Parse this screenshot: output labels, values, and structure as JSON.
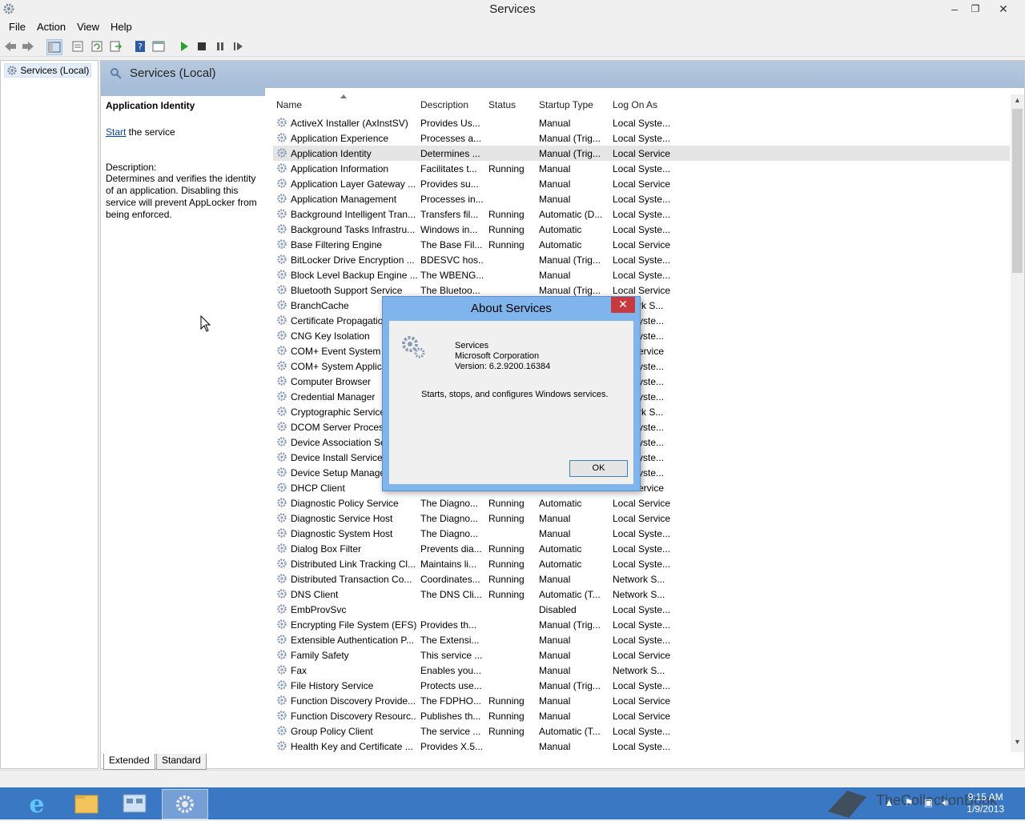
{
  "window": {
    "title": "Services",
    "minimize": "–",
    "restore": "❐",
    "close": "✕"
  },
  "menu": [
    "File",
    "Action",
    "View",
    "Help"
  ],
  "tree": {
    "root": "Services (Local)"
  },
  "pane": {
    "header": "Services (Local)",
    "selected_name": "Application Identity",
    "start_link": "Start",
    "start_suffix": " the service",
    "description_label": "Description:",
    "description_text": "Determines and verifies the identity of an application. Disabling this service will prevent AppLocker from being enforced."
  },
  "columns": [
    "Name",
    "Description",
    "Status",
    "Startup Type",
    "Log On As"
  ],
  "rows": [
    {
      "name": "ActiveX Installer (AxInstSV)",
      "desc": "Provides Us...",
      "status": "",
      "startup": "Manual",
      "logon": "Local Syste..."
    },
    {
      "name": "Application Experience",
      "desc": "Processes a...",
      "status": "",
      "startup": "Manual (Trig...",
      "logon": "Local Syste..."
    },
    {
      "name": "Application Identity",
      "desc": "Determines ...",
      "status": "",
      "startup": "Manual (Trig...",
      "logon": "Local Service"
    },
    {
      "name": "Application Information",
      "desc": "Facilitates t...",
      "status": "Running",
      "startup": "Manual",
      "logon": "Local Syste..."
    },
    {
      "name": "Application Layer Gateway ...",
      "desc": "Provides su...",
      "status": "",
      "startup": "Manual",
      "logon": "Local Service"
    },
    {
      "name": "Application Management",
      "desc": "Processes in...",
      "status": "",
      "startup": "Manual",
      "logon": "Local Syste..."
    },
    {
      "name": "Background Intelligent Tran...",
      "desc": "Transfers fil...",
      "status": "Running",
      "startup": "Automatic (D...",
      "logon": "Local Syste..."
    },
    {
      "name": "Background Tasks Infrastru...",
      "desc": "Windows in...",
      "status": "Running",
      "startup": "Automatic",
      "logon": "Local Syste..."
    },
    {
      "name": "Base Filtering Engine",
      "desc": "The Base Fil...",
      "status": "Running",
      "startup": "Automatic",
      "logon": "Local Service"
    },
    {
      "name": "BitLocker Drive Encryption ...",
      "desc": "BDESVC hos...",
      "status": "",
      "startup": "Manual (Trig...",
      "logon": "Local Syste..."
    },
    {
      "name": "Block Level Backup Engine ...",
      "desc": "The WBENG...",
      "status": "",
      "startup": "Manual",
      "logon": "Local Syste..."
    },
    {
      "name": "Bluetooth Support Service",
      "desc": "The Bluetoo...",
      "status": "",
      "startup": "Manual (Trig...",
      "logon": "Local Service"
    },
    {
      "name": "BranchCache",
      "desc": "",
      "status": "",
      "startup": "",
      "logon": "rk S..."
    },
    {
      "name": "Certificate Propagation",
      "desc": "",
      "status": "",
      "startup": "",
      "logon": "yste..."
    },
    {
      "name": "CNG Key Isolation",
      "desc": "",
      "status": "",
      "startup": "",
      "logon": "yste..."
    },
    {
      "name": "COM+ Event System",
      "desc": "",
      "status": "",
      "startup": "",
      "logon": "ervice"
    },
    {
      "name": "COM+ System Applica",
      "desc": "",
      "status": "",
      "startup": "",
      "logon": "yste..."
    },
    {
      "name": "Computer Browser",
      "desc": "",
      "status": "",
      "startup": "",
      "logon": "yste..."
    },
    {
      "name": "Credential Manager",
      "desc": "",
      "status": "",
      "startup": "",
      "logon": "yste..."
    },
    {
      "name": "Cryptographic Service",
      "desc": "",
      "status": "",
      "startup": "",
      "logon": "rk S..."
    },
    {
      "name": "DCOM Server Process",
      "desc": "",
      "status": "",
      "startup": "",
      "logon": "yste..."
    },
    {
      "name": "Device Association Se",
      "desc": "",
      "status": "",
      "startup": "",
      "logon": "yste..."
    },
    {
      "name": "Device Install Service",
      "desc": "",
      "status": "",
      "startup": "",
      "logon": "yste..."
    },
    {
      "name": "Device Setup Manager",
      "desc": "",
      "status": "",
      "startup": "",
      "logon": "yste..."
    },
    {
      "name": "DHCP Client",
      "desc": "",
      "status": "",
      "startup": "",
      "logon": "ervice"
    },
    {
      "name": "Diagnostic Policy Service",
      "desc": "The Diagno...",
      "status": "Running",
      "startup": "Automatic",
      "logon": "Local Service"
    },
    {
      "name": "Diagnostic Service Host",
      "desc": "The Diagno...",
      "status": "Running",
      "startup": "Manual",
      "logon": "Local Service"
    },
    {
      "name": "Diagnostic System Host",
      "desc": "The Diagno...",
      "status": "",
      "startup": "Manual",
      "logon": "Local Syste..."
    },
    {
      "name": "Dialog Box Filter",
      "desc": "Prevents dia...",
      "status": "Running",
      "startup": "Automatic",
      "logon": "Local Syste..."
    },
    {
      "name": "Distributed Link Tracking Cl...",
      "desc": "Maintains li...",
      "status": "Running",
      "startup": "Automatic",
      "logon": "Local Syste..."
    },
    {
      "name": "Distributed Transaction Co...",
      "desc": "Coordinates...",
      "status": "Running",
      "startup": "Manual",
      "logon": "Network S..."
    },
    {
      "name": "DNS Client",
      "desc": "The DNS Cli...",
      "status": "Running",
      "startup": "Automatic (T...",
      "logon": "Network S..."
    },
    {
      "name": "EmbProvSvc",
      "desc": "",
      "status": "",
      "startup": "Disabled",
      "logon": "Local Syste..."
    },
    {
      "name": "Encrypting File System (EFS)",
      "desc": "Provides th...",
      "status": "",
      "startup": "Manual (Trig...",
      "logon": "Local Syste..."
    },
    {
      "name": "Extensible Authentication P...",
      "desc": "The Extensi...",
      "status": "",
      "startup": "Manual",
      "logon": "Local Syste..."
    },
    {
      "name": "Family Safety",
      "desc": "This service ...",
      "status": "",
      "startup": "Manual",
      "logon": "Local Service"
    },
    {
      "name": "Fax",
      "desc": "Enables you...",
      "status": "",
      "startup": "Manual",
      "logon": "Network S..."
    },
    {
      "name": "File History Service",
      "desc": "Protects use...",
      "status": "",
      "startup": "Manual (Trig...",
      "logon": "Local Syste..."
    },
    {
      "name": "Function Discovery Provide...",
      "desc": "The FDPHO...",
      "status": "Running",
      "startup": "Manual",
      "logon": "Local Service"
    },
    {
      "name": "Function Discovery Resourc...",
      "desc": "Publishes th...",
      "status": "Running",
      "startup": "Manual",
      "logon": "Local Service"
    },
    {
      "name": "Group Policy Client",
      "desc": "The service ...",
      "status": "Running",
      "startup": "Automatic (T...",
      "logon": "Local Syste..."
    },
    {
      "name": "Health Key and Certificate ...",
      "desc": "Provides X.5...",
      "status": "",
      "startup": "Manual",
      "logon": "Local Syste..."
    }
  ],
  "tabs": [
    "Extended",
    "Standard"
  ],
  "dialog": {
    "title": "About Services",
    "close": "✕",
    "product": "Services",
    "company": "Microsoft Corporation",
    "version": "Version: 6.2.9200.16384",
    "message": "Starts, stops, and configures Windows services.",
    "ok": "OK"
  },
  "taskbar": {
    "time": "9:15 AM",
    "date": "1/9/2013",
    "watermark": "TheCollectionBook"
  },
  "icons": {
    "back": "back-arrow-icon",
    "forward": "forward-arrow-icon",
    "start": "play-icon",
    "stop": "stop-icon",
    "pause": "pause-icon",
    "restart": "restart-icon"
  }
}
